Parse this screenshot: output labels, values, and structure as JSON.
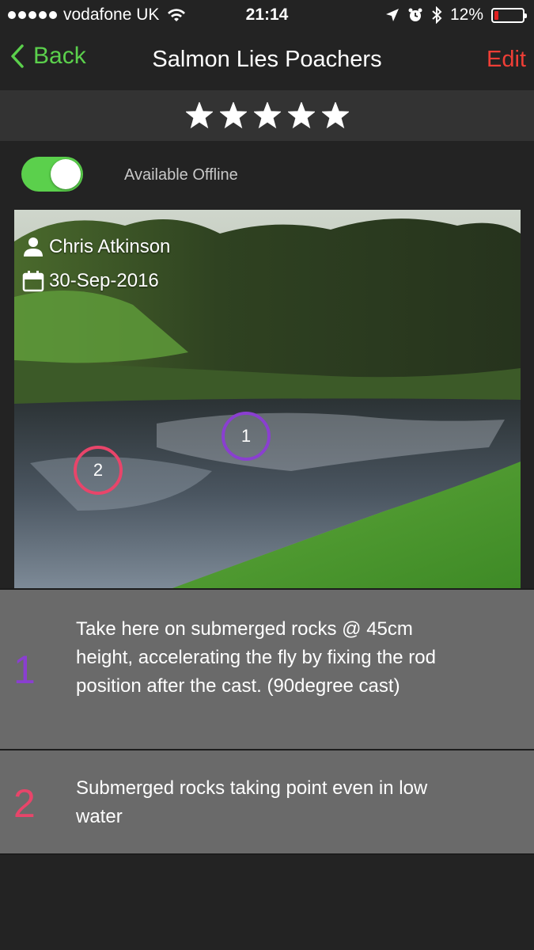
{
  "status_bar": {
    "carrier": "vodafone UK",
    "time": "21:14",
    "battery_percent": "12%",
    "battery_level": 0.12,
    "icons": [
      "signal-dots-icon",
      "wifi-icon",
      "location-arrow-icon",
      "alarm-icon",
      "bluetooth-icon",
      "battery-icon"
    ]
  },
  "nav": {
    "back_label": "Back",
    "title": "Salmon Lies Poachers",
    "edit_label": "Edit"
  },
  "rating": {
    "value": 5,
    "max": 5
  },
  "offline": {
    "label": "Available Offline",
    "enabled": true
  },
  "photo": {
    "author": "Chris Atkinson",
    "date": "30-Sep-2016",
    "markers": [
      {
        "label": "1",
        "color": "#8a3fd0"
      },
      {
        "label": "2",
        "color": "#e8456a"
      }
    ]
  },
  "notes": [
    {
      "number": "1",
      "color": "#8a3fd0",
      "text": "Take here on submerged rocks @ 45cm height, accelerating the fly by fixing the rod position after the cast.  (90degree cast)"
    },
    {
      "number": "2",
      "color": "#e8456a",
      "text": "Submerged rocks taking point even in low water"
    }
  ],
  "colors": {
    "accent_green": "#5bd04c",
    "edit_red": "#ef3e36",
    "background": "#232323",
    "note_background": "#6a6a6a"
  }
}
